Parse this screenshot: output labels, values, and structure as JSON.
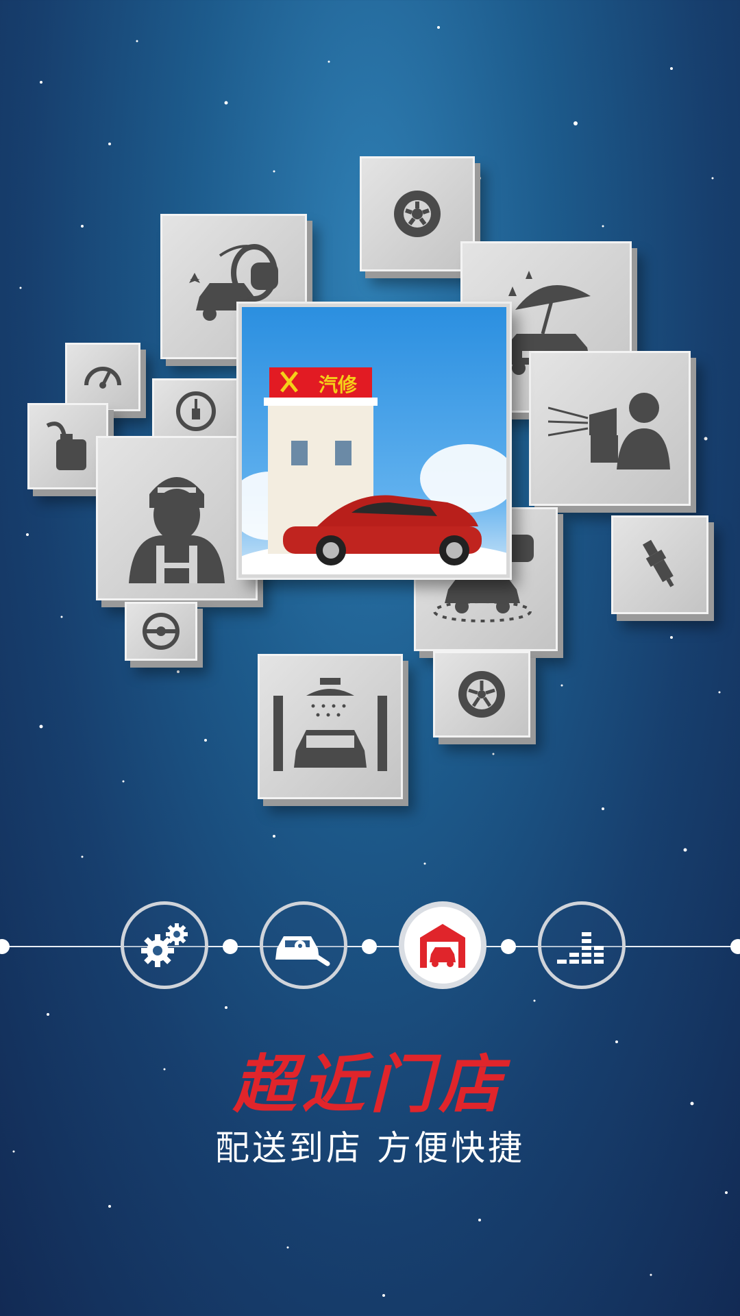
{
  "hero": {
    "shop_sign": "汽修"
  },
  "steps": [
    {
      "icon": "gears-icon"
    },
    {
      "icon": "car-wrench-icon"
    },
    {
      "icon": "garage-car-icon",
      "active": true
    },
    {
      "icon": "equalizer-icon"
    }
  ],
  "headline": {
    "title": "超近门店",
    "subtitle": "配送到店   方便快捷"
  },
  "colors": {
    "accent": "#e0252b",
    "background": "#173f6e",
    "tile": "#d4d4d4",
    "icon": "#4a4a4a"
  }
}
